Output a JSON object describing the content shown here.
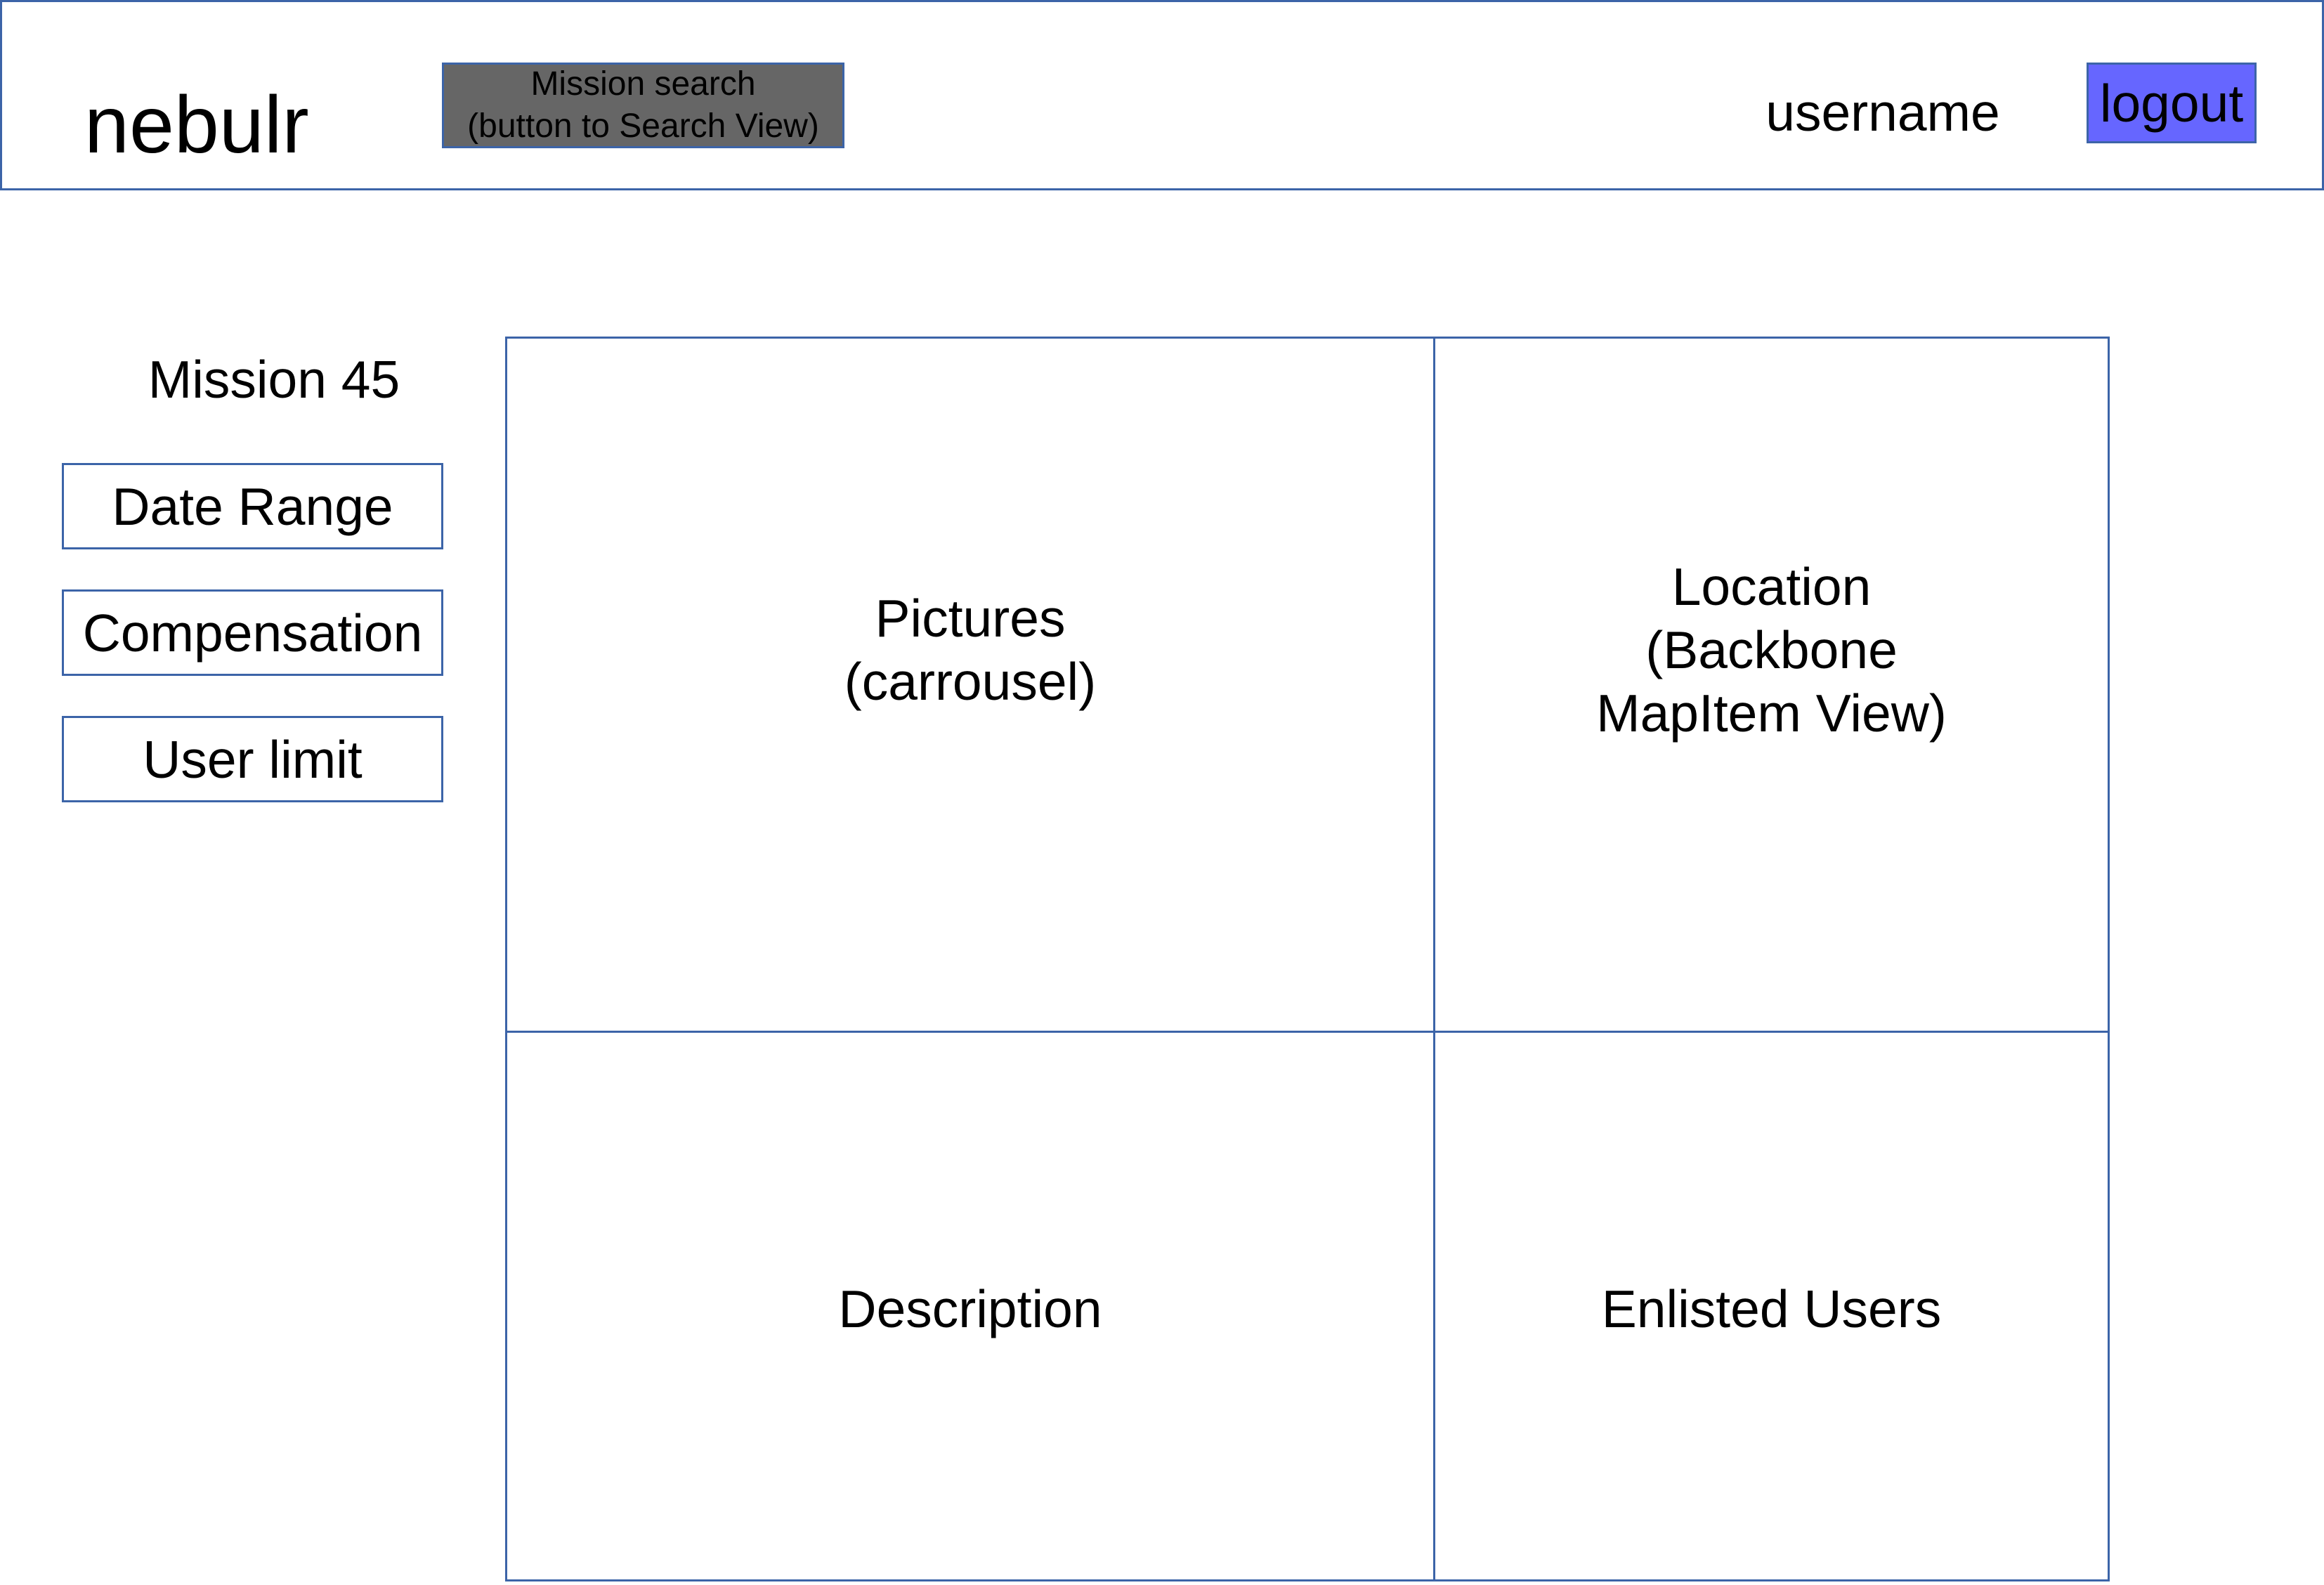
{
  "header": {
    "logo": "nebulr",
    "search_button": "Mission search\n(button to Search View)",
    "username": "username",
    "logout_button": "logout"
  },
  "sidebar": {
    "mission_title": "Mission 45",
    "items": [
      {
        "label": "Date Range"
      },
      {
        "label": "Compensation"
      },
      {
        "label": "User limit"
      }
    ]
  },
  "main": {
    "pictures": "Pictures\n(carrousel)",
    "location": "Location\n(Backbone\nMapItem View)",
    "description": "Description",
    "enlisted_users": "Enlisted Users"
  },
  "colors": {
    "border": "#3c64a8",
    "search_button_bg": "#666666",
    "logout_button_bg": "#6666ff"
  }
}
